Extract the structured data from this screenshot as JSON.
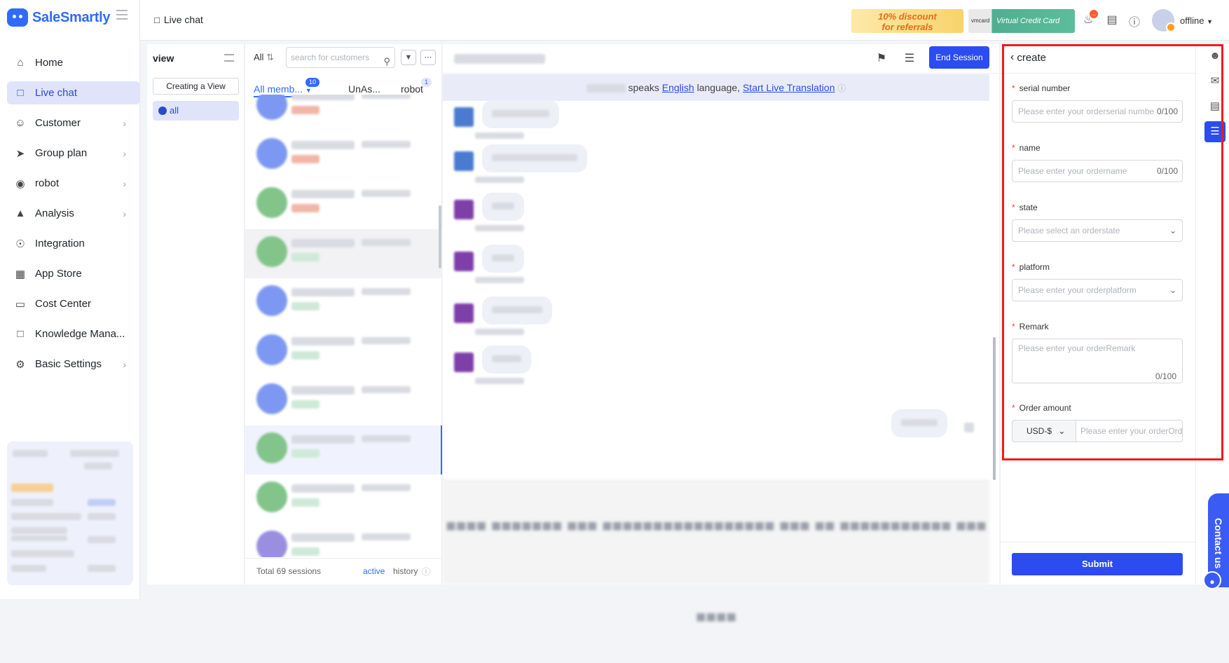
{
  "app": {
    "name": "SaleSmartly"
  },
  "nav": {
    "items": [
      {
        "label": "Home",
        "icon": "home-icon",
        "active": false,
        "chevron": false
      },
      {
        "label": "Live chat",
        "icon": "chat-icon",
        "active": true,
        "chevron": false
      },
      {
        "label": "Customer",
        "icon": "users-icon",
        "active": false,
        "chevron": true
      },
      {
        "label": "Group plan",
        "icon": "send-icon",
        "active": false,
        "chevron": true
      },
      {
        "label": "robot",
        "icon": "robot-icon",
        "active": false,
        "chevron": true
      },
      {
        "label": "Analysis",
        "icon": "chart-icon",
        "active": false,
        "chevron": true
      },
      {
        "label": "Integration",
        "icon": "integration-icon",
        "active": false,
        "chevron": false
      },
      {
        "label": "App Store",
        "icon": "apps-icon",
        "active": false,
        "chevron": false
      },
      {
        "label": "Cost Center",
        "icon": "wallet-icon",
        "active": false,
        "chevron": false
      },
      {
        "label": "Knowledge Mana...",
        "icon": "book-icon",
        "active": false,
        "chevron": false
      },
      {
        "label": "Basic Settings",
        "icon": "settings-icon",
        "active": false,
        "chevron": true
      }
    ]
  },
  "topbar": {
    "breadcrumb": "Live chat",
    "promo_discount": "10% discount\nfor referrals",
    "promo_card_brand": "vmcard",
    "promo_card": "Virtual Credit Card",
    "notification_count": "...",
    "status": "offline"
  },
  "view_panel": {
    "title": "view",
    "create_label": "Creating a View",
    "all_label": "all"
  },
  "sessions": {
    "filter_label": "All",
    "search_placeholder": "search for customers",
    "tabs": [
      {
        "label": "All memb...",
        "badge": "10"
      },
      {
        "label": "UnAs...",
        "badge": ""
      },
      {
        "label": "robot",
        "badge": "1"
      }
    ],
    "total_label": "Total 69 sessions",
    "active_label": "active",
    "history_label": "history"
  },
  "chat": {
    "end_session_label": "End Session",
    "translation_prefix": "speaks",
    "translation_language": "English",
    "translation_mid": "language,",
    "translation_link": "Start Live Translation"
  },
  "order_form": {
    "back_label": "create",
    "fields": {
      "serial": {
        "label": "serial number",
        "placeholder": "Please enter your orderserial number",
        "count": "0/100"
      },
      "name": {
        "label": "name",
        "placeholder": "Please enter your ordername",
        "count": "0/100"
      },
      "state": {
        "label": "state",
        "placeholder": "Please select an orderstate"
      },
      "platform": {
        "label": "platform",
        "placeholder": "Please enter your orderplatform"
      },
      "remark": {
        "label": "Remark",
        "placeholder": "Please enter your orderRemark",
        "count": "0/100"
      },
      "amount": {
        "label": "Order amount",
        "currency": "USD-$",
        "placeholder": "Please enter your orderOrder amount"
      }
    },
    "submit_label": "Submit"
  },
  "contact_us": "Contact us",
  "colors": {
    "accent": "#2b4cf0",
    "highlight_border": "#ee1c1c",
    "active_nav_bg": "#dfe4fb"
  }
}
